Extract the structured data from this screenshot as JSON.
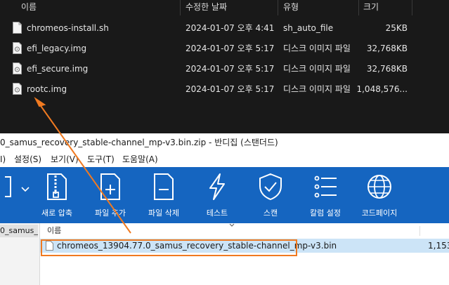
{
  "explorer": {
    "columns": {
      "name": "이름",
      "date": "수정한 날짜",
      "type": "유형",
      "size": "크기"
    },
    "files": [
      {
        "name": "chromeos-install.sh",
        "date": "2024-01-07 오후 4:41",
        "type": "sh_auto_file",
        "size": "25KB"
      },
      {
        "name": "efi_legacy.img",
        "date": "2024-01-07 오후 5:17",
        "type": "디스크 이미지 파일",
        "size": "32,768KB"
      },
      {
        "name": "efi_secure.img",
        "date": "2024-01-07 오후 5:17",
        "type": "디스크 이미지 파일",
        "size": "32,768KB"
      },
      {
        "name": "rootc.img",
        "date": "2024-01-07 오후 5:17",
        "type": "디스크 이미지 파일",
        "size": "1,048,576..."
      }
    ]
  },
  "bandizip": {
    "title": "0_samus_recovery_stable-channel_mp-v3.bin.zip - 반디집 (스탠더드)",
    "menu": [
      "I)",
      "설정(S)",
      "보기(V)",
      "도구(T)",
      "도움말(A)"
    ],
    "toolbar": [
      {
        "label": "새로 압축",
        "icon": "zip-archive-icon"
      },
      {
        "label": "파일 추가",
        "icon": "add-file-icon"
      },
      {
        "label": "파일 삭제",
        "icon": "delete-file-icon"
      },
      {
        "label": "테스트",
        "icon": "lightning-icon"
      },
      {
        "label": "스캔",
        "icon": "shield-check-icon"
      },
      {
        "label": "칼럼 설정",
        "icon": "column-list-icon"
      },
      {
        "label": "코드페이지",
        "icon": "globe-icon"
      }
    ],
    "sidebar_item": "0_samus_r",
    "list_header": "이름",
    "entry": {
      "name": "chromeos_13904.77.0_samus_recovery_stable-channel_mp-v3.bin",
      "size": "1,153"
    }
  },
  "colors": {
    "toolbar_bg": "#1565c0",
    "highlight": "#f07a21",
    "explorer_bg": "#191919",
    "selection": "#cce4f7"
  }
}
